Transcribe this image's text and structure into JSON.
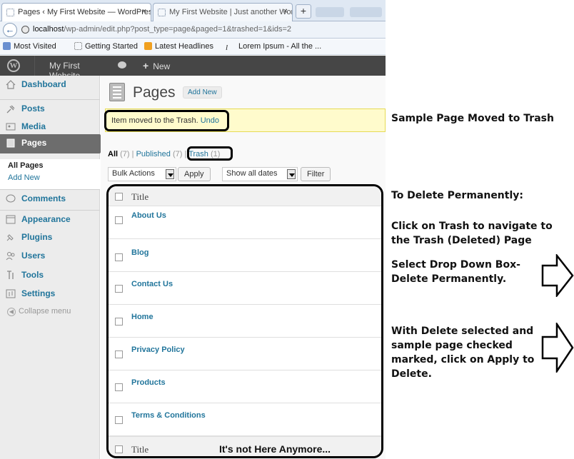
{
  "browser": {
    "tabs": [
      {
        "label": "Pages ‹ My First Website — WordPress",
        "close": "×"
      },
      {
        "label": "My First Website | Just another Word...",
        "close": "×"
      }
    ],
    "new_tab": "+",
    "url_host": "localhost",
    "url_path": "/wp-admin/edit.php?post_type=page&paged=1&trashed=1&ids=2",
    "back": "←",
    "bookmarks": [
      "Most Visited",
      "Getting Started",
      "Latest Headlines",
      "Lorem Ipsum - All the ..."
    ]
  },
  "adminbar": {
    "logo": "W",
    "site_name": "My First Website",
    "new_label": "New",
    "new_plus": "+"
  },
  "sidebar": {
    "items": [
      {
        "label": "Dashboard",
        "icon": "home-icon"
      },
      {
        "label": "Posts",
        "icon": "pin-icon"
      },
      {
        "label": "Media",
        "icon": "media-icon"
      },
      {
        "label": "Pages",
        "icon": "pages-icon"
      },
      {
        "label": "Comments",
        "icon": "comment-icon"
      },
      {
        "label": "Appearance",
        "icon": "appearance-icon"
      },
      {
        "label": "Plugins",
        "icon": "plugin-icon"
      },
      {
        "label": "Users",
        "icon": "users-icon"
      },
      {
        "label": "Tools",
        "icon": "tools-icon"
      },
      {
        "label": "Settings",
        "icon": "settings-icon"
      }
    ],
    "sub_all_pages": "All Pages",
    "sub_add_new": "Add New",
    "collapse": "Collapse menu"
  },
  "main": {
    "title": "Pages",
    "add_new": "Add New",
    "notice_text": "Item moved to the Trash.",
    "notice_undo": "Undo",
    "filters": {
      "all": "All",
      "all_count": "(7)",
      "sep": "|",
      "published": "Published",
      "published_count": "(7)",
      "trash": "Trash",
      "trash_count": "(1)"
    },
    "bulk_actions": "Bulk Actions",
    "apply": "Apply",
    "dates": "Show all dates",
    "filter": "Filter",
    "column_title": "Title",
    "rows": [
      "About Us",
      "Blog",
      "Contact Us",
      "Home",
      "Privacy Policy",
      "Products",
      "Terms & Conditions"
    ],
    "not_here": "It's not Here Anymore..."
  },
  "annotations": {
    "title": "Sample Page Moved to Trash",
    "delete_heading": "To Delete Permanently:",
    "step1": "Click on Trash to navigate to the Trash (Deleted) Page",
    "step2": "Select Drop Down Box- Delete Permanently.",
    "step3": "With Delete selected and sample page checked marked, click on Apply to Delete."
  },
  "colors": {
    "link": "#21759b",
    "adminbar": "#464646",
    "notice_bg": "#fffbcc",
    "sidebar_active": "#6d6d6d"
  }
}
